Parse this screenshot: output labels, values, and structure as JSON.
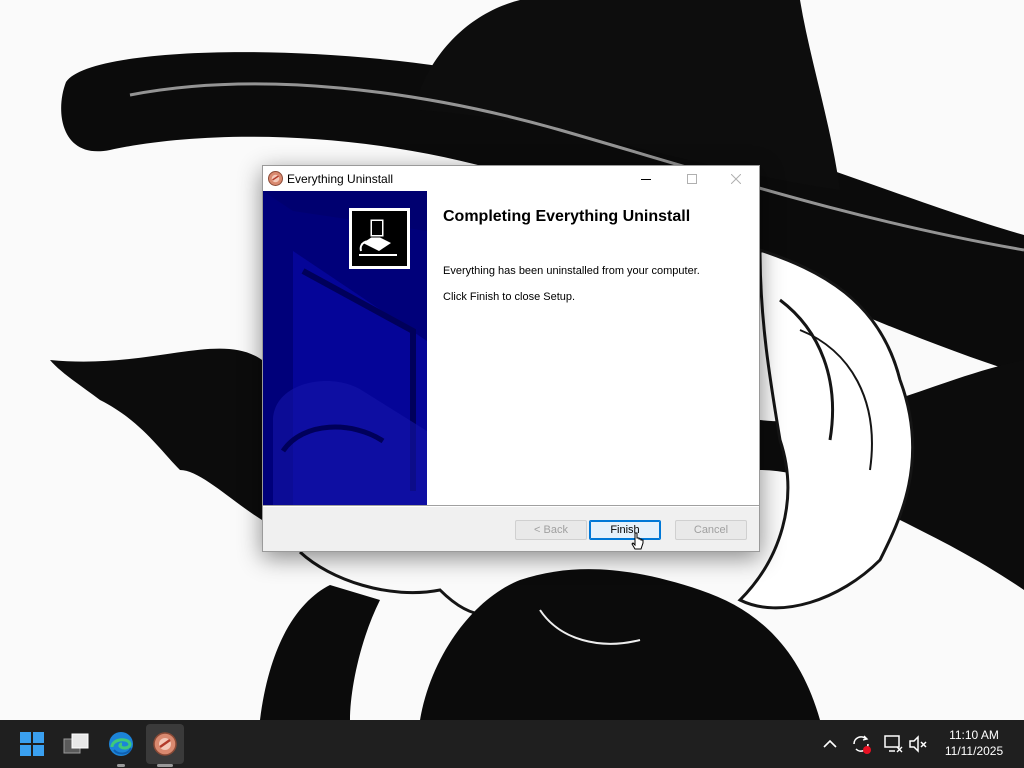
{
  "dialog": {
    "title": "Everything Uninstall",
    "heading": "Completing Everything Uninstall",
    "message1": "Everything has been uninstalled from your computer.",
    "message2": "Click Finish to close Setup.",
    "buttons": {
      "back": "< Back",
      "finish": "Finish",
      "cancel": "Cancel"
    },
    "focused_button": "finish",
    "banner_color": "#00007a"
  },
  "taskbar": {
    "pinned": [
      "windows-start-icon",
      "task-view-icon",
      "edge-browser-icon",
      "uninstaller-app-icon"
    ],
    "tray": [
      "chevron-up-icon",
      "sync-icon",
      "network-icon",
      "volume-muted-icon"
    ],
    "time": "11:10 AM",
    "date": "11/11/2025"
  },
  "colors": {
    "accent": "#0078d7",
    "taskbar": "#1f1f1f"
  }
}
